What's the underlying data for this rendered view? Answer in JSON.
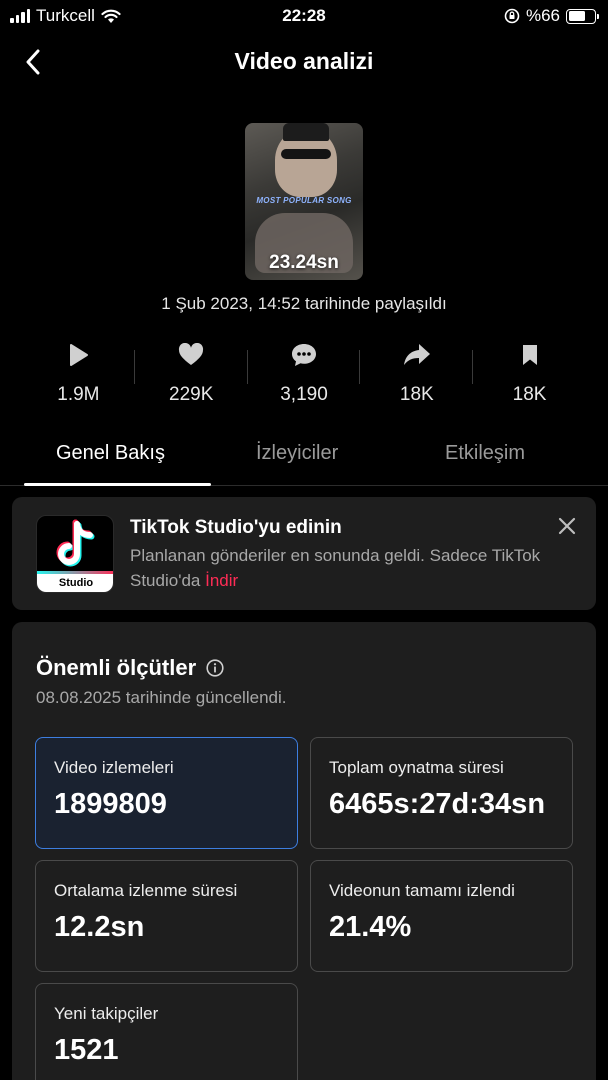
{
  "status_bar": {
    "carrier": "Turkcell",
    "time": "22:28",
    "battery": "%66"
  },
  "header": {
    "title": "Video analizi"
  },
  "video": {
    "thumbnail_caption": "MOST POPULAR SONG",
    "duration": "23.24sn",
    "shared_date": "1 Şub 2023, 14:52 tarihinde paylaşıldı"
  },
  "stats": {
    "views": "1.9M",
    "likes": "229K",
    "comments": "3,190",
    "shares": "18K",
    "saves": "18K"
  },
  "tabs": [
    {
      "label": "Genel Bakış",
      "active": true
    },
    {
      "label": "İzleyiciler",
      "active": false
    },
    {
      "label": "Etkileşim",
      "active": false
    }
  ],
  "promo": {
    "logo_text": "Studio",
    "title": "TikTok Studio'yu edinin",
    "description": "Planlanan gönderiler en sonunda geldi. Sadece TikTok Studio'da",
    "link": "İndir"
  },
  "metrics": {
    "title": "Önemli ölçütler",
    "updated": "08.08.2025 tarihinde güncellendi.",
    "items": [
      {
        "label": "Video izlemeleri",
        "value": "1899809"
      },
      {
        "label": "Toplam oynatma süresi",
        "value": "6465s:27d:34sn"
      },
      {
        "label": "Ortalama izlenme süresi",
        "value": "12.2sn"
      },
      {
        "label": "Videonun tamamı izlendi",
        "value": "21.4%"
      },
      {
        "label": "Yeni takipçiler",
        "value": "1521"
      }
    ]
  },
  "colors": {
    "accent_link": "#fe2c55",
    "selected_border": "#3d7ee0",
    "background": "#000000",
    "card": "#1e1e1e"
  }
}
